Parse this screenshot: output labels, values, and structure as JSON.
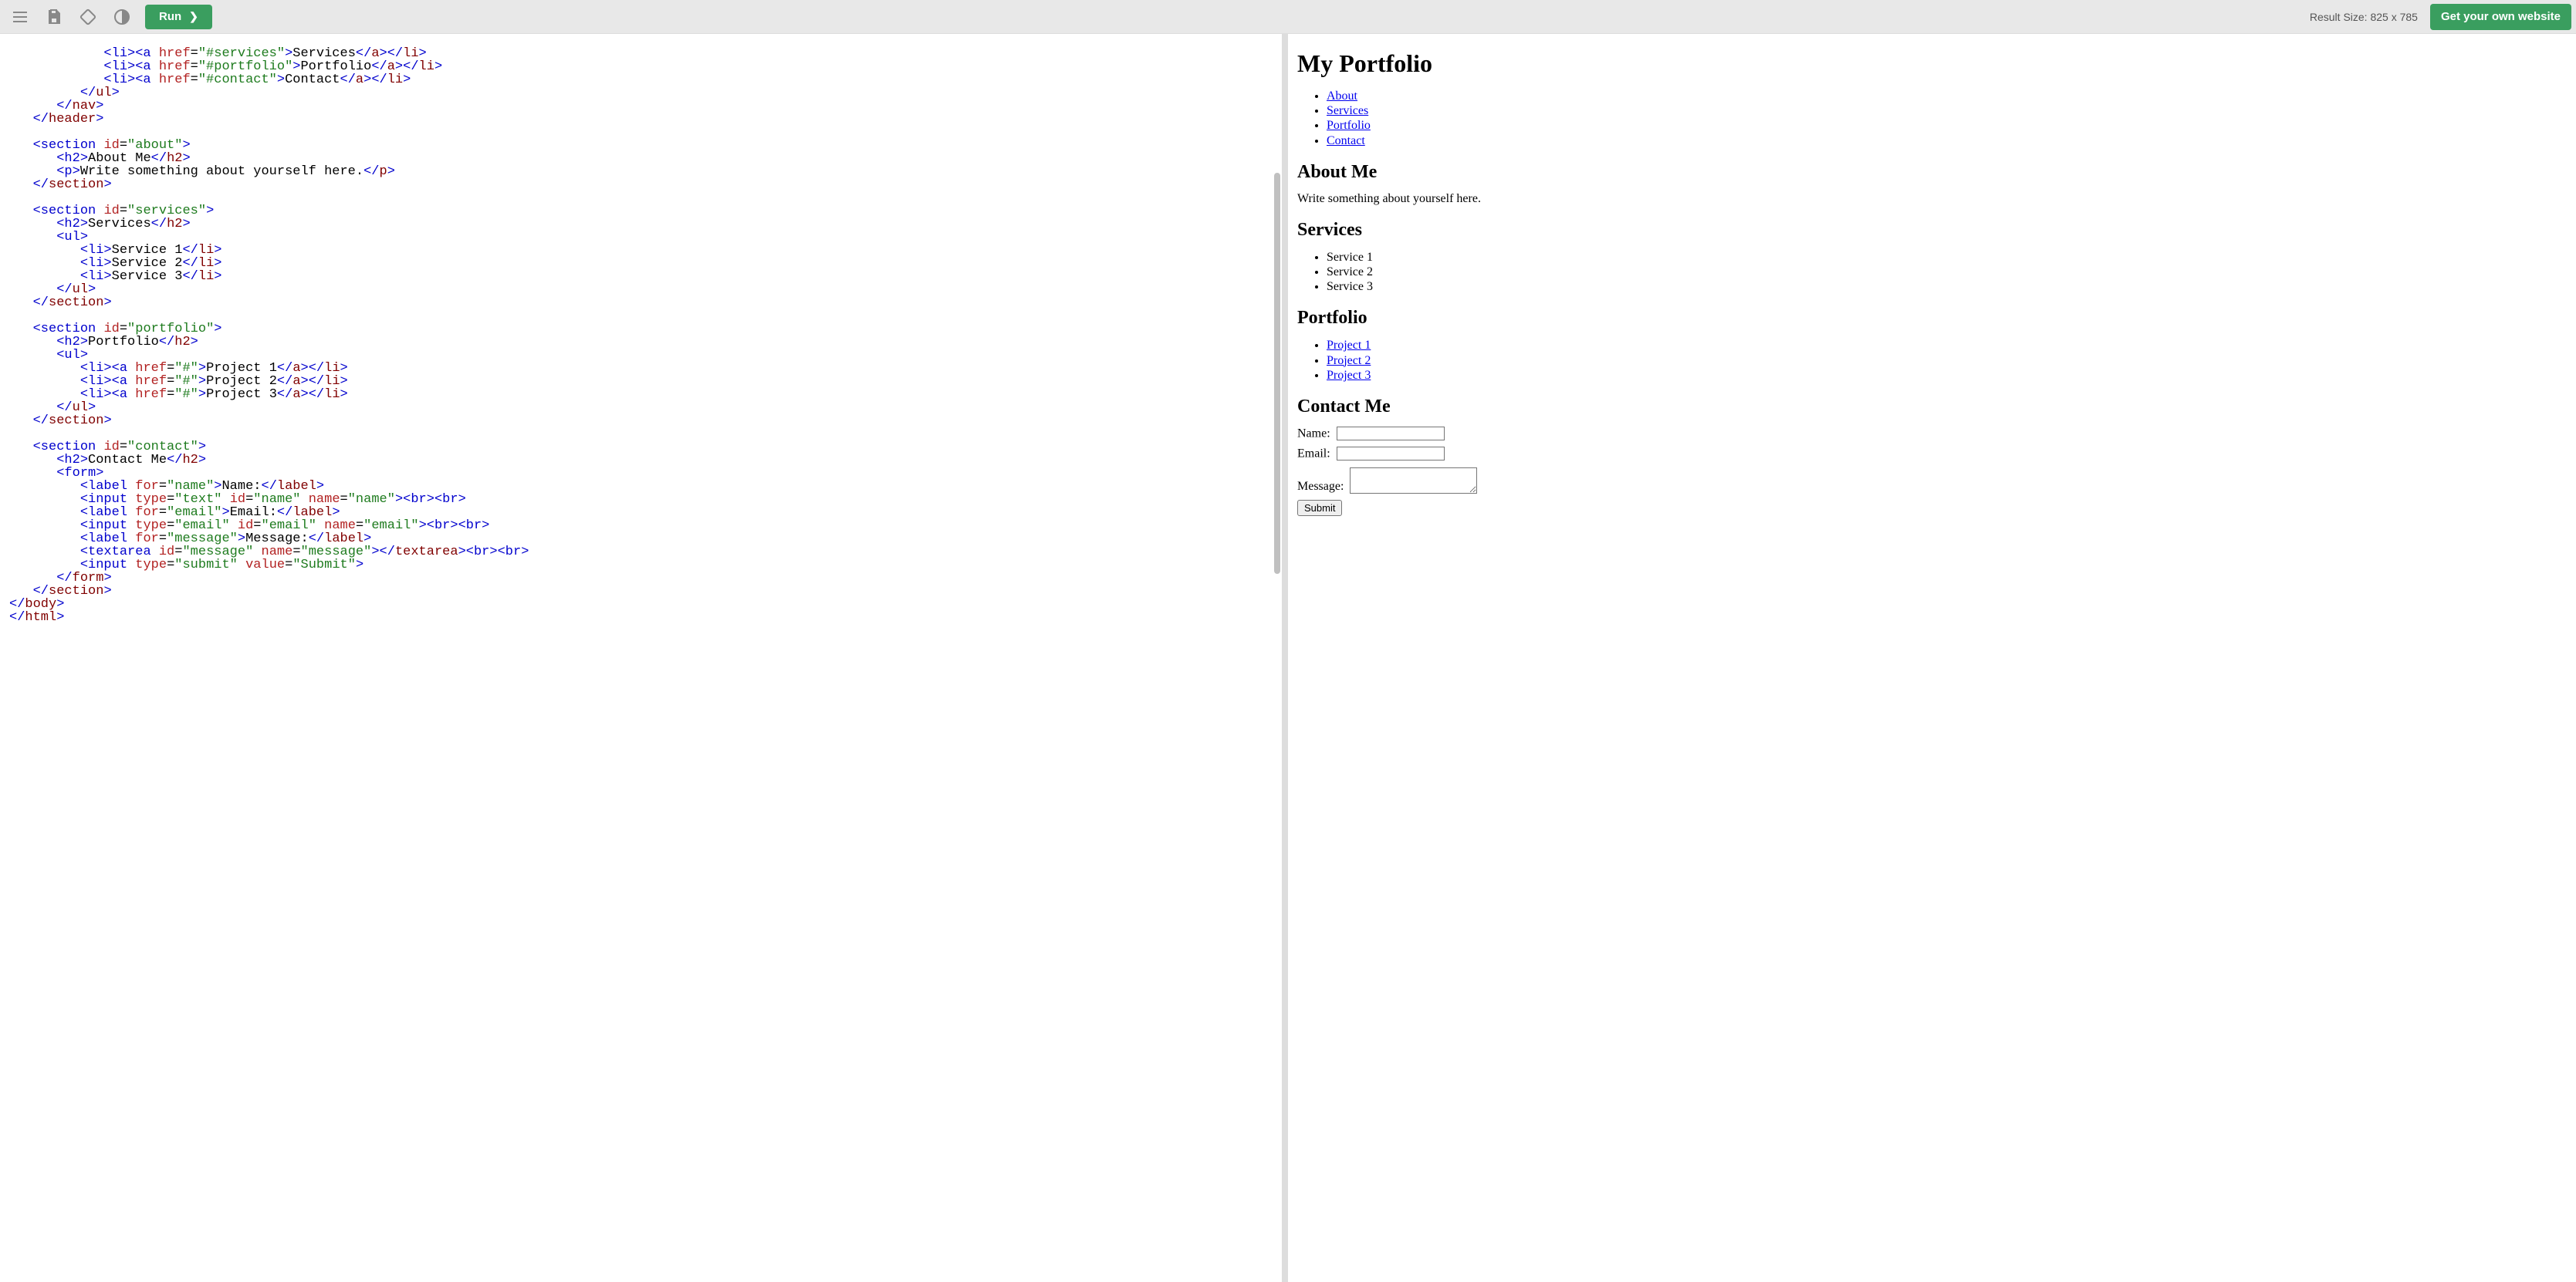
{
  "topbar": {
    "run_label": "Run",
    "result_size_label": "Result Size: 825 x 785",
    "cta_label": "Get your own website"
  },
  "output": {
    "h1": "My Portfolio",
    "nav": [
      "About",
      "Services",
      "Portfolio",
      "Contact"
    ],
    "about": {
      "heading": "About Me",
      "text": "Write something about yourself here."
    },
    "services": {
      "heading": "Services",
      "items": [
        "Service 1",
        "Service 2",
        "Service 3"
      ]
    },
    "portfolio": {
      "heading": "Portfolio",
      "items": [
        "Project 1",
        "Project 2",
        "Project 3"
      ]
    },
    "contact": {
      "heading": "Contact Me",
      "name_label": "Name:",
      "email_label": "Email:",
      "message_label": "Message:",
      "submit_label": "Submit"
    }
  },
  "code": {
    "l1": {
      "open_li": "<li>",
      "open_a": "<a ",
      "href": "href",
      "eq": "=",
      "val": "\"#services\"",
      "gt": ">",
      "txt": "Services",
      "close_a": "</a>",
      "close_li": "</li>"
    },
    "l2": {
      "open_li": "<li>",
      "open_a": "<a ",
      "href": "href",
      "eq": "=",
      "val": "\"#portfolio\"",
      "gt": ">",
      "txt": "Portfolio",
      "close_a": "</a>",
      "close_li": "</li>"
    },
    "l3": {
      "open_li": "<li>",
      "open_a": "<a ",
      "href": "href",
      "eq": "=",
      "val": "\"#contact\"",
      "gt": ">",
      "txt": "Contact",
      "close_a": "</a>",
      "close_li": "</li>"
    },
    "l4": "</ul>",
    "l5": "</nav>",
    "l6": "</header>",
    "l7": {
      "sec": "<section ",
      "id": "id",
      "eq": "=",
      "val": "\"about\"",
      "gt": ">"
    },
    "l8": {
      "open": "<h2>",
      "txt": "About Me",
      "close": "</h2>"
    },
    "l9": {
      "open": "<p>",
      "txt": "Write something about yourself here.",
      "close": "</p>"
    },
    "l10": "</section>",
    "l11": {
      "sec": "<section ",
      "id": "id",
      "eq": "=",
      "val": "\"services\"",
      "gt": ">"
    },
    "l12": {
      "open": "<h2>",
      "txt": "Services",
      "close": "</h2>"
    },
    "l13": "<ul>",
    "l14": {
      "open": "<li>",
      "txt": "Service 1",
      "close": "</li>"
    },
    "l15": {
      "open": "<li>",
      "txt": "Service 2",
      "close": "</li>"
    },
    "l16": {
      "open": "<li>",
      "txt": "Service 3",
      "close": "</li>"
    },
    "l17": "</ul>",
    "l18": "</section>",
    "l19": {
      "sec": "<section ",
      "id": "id",
      "eq": "=",
      "val": "\"portfolio\"",
      "gt": ">"
    },
    "l20": {
      "open": "<h2>",
      "txt": "Portfolio",
      "close": "</h2>"
    },
    "l21": "<ul>",
    "l22": {
      "open_li": "<li>",
      "open_a": "<a ",
      "href": "href",
      "eq": "=",
      "val": "\"#\"",
      "gt": ">",
      "txt": "Project 1",
      "close_a": "</a>",
      "close_li": "</li>"
    },
    "l23": {
      "open_li": "<li>",
      "open_a": "<a ",
      "href": "href",
      "eq": "=",
      "val": "\"#\"",
      "gt": ">",
      "txt": "Project 2",
      "close_a": "</a>",
      "close_li": "</li>"
    },
    "l24": {
      "open_li": "<li>",
      "open_a": "<a ",
      "href": "href",
      "eq": "=",
      "val": "\"#\"",
      "gt": ">",
      "txt": "Project 3",
      "close_a": "</a>",
      "close_li": "</li>"
    },
    "l25": "</ul>",
    "l26": "</section>",
    "l27": {
      "sec": "<section ",
      "id": "id",
      "eq": "=",
      "val": "\"contact\"",
      "gt": ">"
    },
    "l28": {
      "open": "<h2>",
      "txt": "Contact Me",
      "close": "</h2>"
    },
    "l29": "<form>",
    "l30": {
      "open": "<label ",
      "for": "for",
      "eq": "=",
      "val": "\"name\"",
      "gt": ">",
      "txt": "Name:",
      "close": "</label>"
    },
    "l31": {
      "open": "<input ",
      "type": "type",
      "eq1": "=",
      "val1": "\"text\"",
      "id": "id",
      "eq2": "=",
      "val2": "\"name\"",
      "name": "name",
      "eq3": "=",
      "val3": "\"name\"",
      "gt": ">",
      "br": "<br><br>"
    },
    "l32": {
      "open": "<label ",
      "for": "for",
      "eq": "=",
      "val": "\"email\"",
      "gt": ">",
      "txt": "Email:",
      "close": "</label>"
    },
    "l33": {
      "open": "<input ",
      "type": "type",
      "eq1": "=",
      "val1": "\"email\"",
      "id": "id",
      "eq2": "=",
      "val2": "\"email\"",
      "name": "name",
      "eq3": "=",
      "val3": "\"email\"",
      "gt": ">",
      "br": "<br><br>"
    },
    "l34": {
      "open": "<label ",
      "for": "for",
      "eq": "=",
      "val": "\"message\"",
      "gt": ">",
      "txt": "Message:",
      "close": "</label>"
    },
    "l35": {
      "open": "<textarea ",
      "id": "id",
      "eq1": "=",
      "val1": "\"message\"",
      "name": "name",
      "eq2": "=",
      "val2": "\"message\"",
      "gt": ">",
      "close": "</textarea>",
      "br": "<br><br>"
    },
    "l36": {
      "open": "<input ",
      "type": "type",
      "eq1": "=",
      "val1": "\"submit\"",
      "value": "value",
      "eq2": "=",
      "val2": "\"Submit\"",
      "gt": ">"
    },
    "l37": "</form>",
    "l38": "</section>",
    "l39": "</body>",
    "l40": "</html>"
  }
}
